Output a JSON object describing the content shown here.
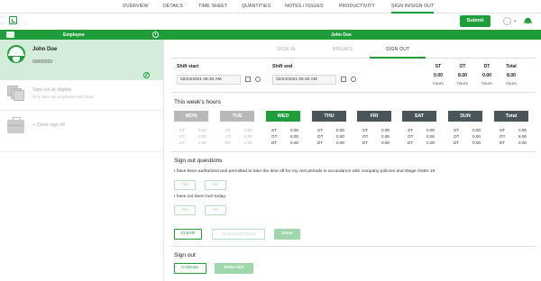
{
  "nav": {
    "tabs": [
      "OVERVIEW",
      "DETAILS",
      "TIME SHEET",
      "QUANTITIES",
      "NOTES / ISSUES",
      "PRODUCTIVITY",
      "SIGN IN/SIGN OUT"
    ],
    "active": "SIGN IN/SIGN OUT"
  },
  "toolbar": {
    "submit_label": "Submit",
    "user_initial": "↓"
  },
  "header": {
    "employee_label": "Employee",
    "selected_name": "John Doe"
  },
  "employee": {
    "name": "John Doe",
    "id": "00000000"
  },
  "left": {
    "signout_all_title": "Sign out all eligible",
    "signout_all_sub": "Only signs out employees with hours",
    "client_signoff": "+ Client sign off"
  },
  "tabs": [
    "SIGN IN",
    "BREAKS",
    "SIGN OUT"
  ],
  "active_tab": "SIGN OUT",
  "shift": {
    "start_label": "Shift start",
    "start_value": "02/24/2021 06:30 AM",
    "end_label": "Shift end",
    "end_value": "02/24/2021 06:30 AM"
  },
  "stats": {
    "headers": [
      "ST",
      "OT",
      "DT",
      "Total"
    ],
    "values": [
      "0.00",
      "8.00",
      "0.00",
      "8.00"
    ],
    "unit": "hours"
  },
  "week": {
    "title": "This week's hours",
    "days": [
      {
        "label": "MON",
        "style": "grey",
        "st": "0.00",
        "ot": "0.00",
        "dt": "0.00"
      },
      {
        "label": "TUE",
        "style": "grey",
        "st": "0.00",
        "ot": "0.00",
        "dt": "0.00"
      },
      {
        "label": "WED",
        "style": "green",
        "st": "0.00",
        "ot": "8.00",
        "dt": "0.00"
      },
      {
        "label": "THU",
        "style": "dark",
        "st": "0.00",
        "ot": "0.00",
        "dt": "0.00"
      },
      {
        "label": "FRI",
        "style": "dark",
        "st": "0.00",
        "ot": "0.00",
        "dt": "0.00"
      },
      {
        "label": "SAT",
        "style": "dark",
        "st": "0.00",
        "ot": "0.00",
        "dt": "0.00"
      },
      {
        "label": "SUN",
        "style": "dark",
        "st": "0.00",
        "ot": "0.00",
        "dt": "0.00"
      },
      {
        "label": "Total",
        "style": "dark",
        "st": "0.00",
        "ot": "8.00",
        "dt": "0.00"
      }
    ],
    "row_keys": [
      "ST",
      "OT",
      "DT"
    ]
  },
  "questions": {
    "title": "Sign out questions",
    "q1": "I have been authorized and permitted to take the time off for my rest periods in accordance with company policies and Wage Order 16",
    "q2": "I have not been hurt today.",
    "yes": "Yes",
    "no": "No",
    "clear": "CLEAR",
    "no_exceptions": "NO EXCEPTIONS",
    "done": "Done"
  },
  "signout": {
    "title": "Sign out",
    "cancel": "CANCEL",
    "signout": "SIGN OUT"
  },
  "colors": {
    "brand": "#1f9d3a",
    "dark": "#4a5559",
    "grey": "#b8b8b8"
  }
}
